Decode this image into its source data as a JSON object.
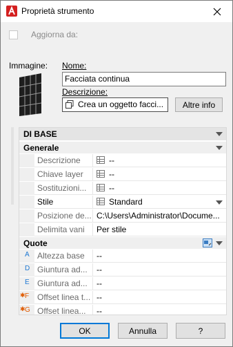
{
  "window": {
    "title": "Proprietà strumento"
  },
  "update_from": {
    "label": "Aggiorna da:",
    "checked": false
  },
  "image": {
    "label": "Immagine:"
  },
  "name": {
    "label": "Nome:",
    "value": "Facciata continua"
  },
  "description": {
    "label": "Descrizione:",
    "value": "Crea un oggetto facci...",
    "more_button": "Altre info"
  },
  "panel": {
    "section_basic": "DI BASE",
    "group_general": "Generale",
    "general_rows": [
      {
        "name": "Descrizione",
        "value": "--",
        "icon": "table-icon"
      },
      {
        "name": "Chiave layer",
        "value": "--",
        "icon": "table-icon"
      },
      {
        "name": "Sostituzioni...",
        "value": "--",
        "icon": "table-icon"
      },
      {
        "name": "Stile",
        "value": "Standard",
        "icon": "table-icon"
      },
      {
        "name": "Posizione de...",
        "value": "C:\\Users\\Administrator\\Docume..."
      },
      {
        "name": "Delimita vani",
        "value": "Per stile"
      }
    ],
    "group_dimensions": "Quote",
    "dimension_rows": [
      {
        "letter": "A",
        "name": "Altezza base",
        "value": "--"
      },
      {
        "letter": "D",
        "name": "Giuntura ad...",
        "value": "--"
      },
      {
        "letter": "E",
        "name": "Giuntura ad...",
        "value": "--"
      },
      {
        "letter": "F",
        "name": "Offset linea t...",
        "value": "--",
        "star": true
      },
      {
        "letter": "G",
        "name": "Offset linea...",
        "value": "--",
        "star": true
      }
    ]
  },
  "buttons": {
    "ok": "OK",
    "cancel": "Annulla",
    "help": "?"
  },
  "colors": {
    "accent": "#0078d7",
    "letter_blue": "#1d78d2",
    "letter_orange": "#e05a00",
    "app_icon_red": "#d42020"
  }
}
